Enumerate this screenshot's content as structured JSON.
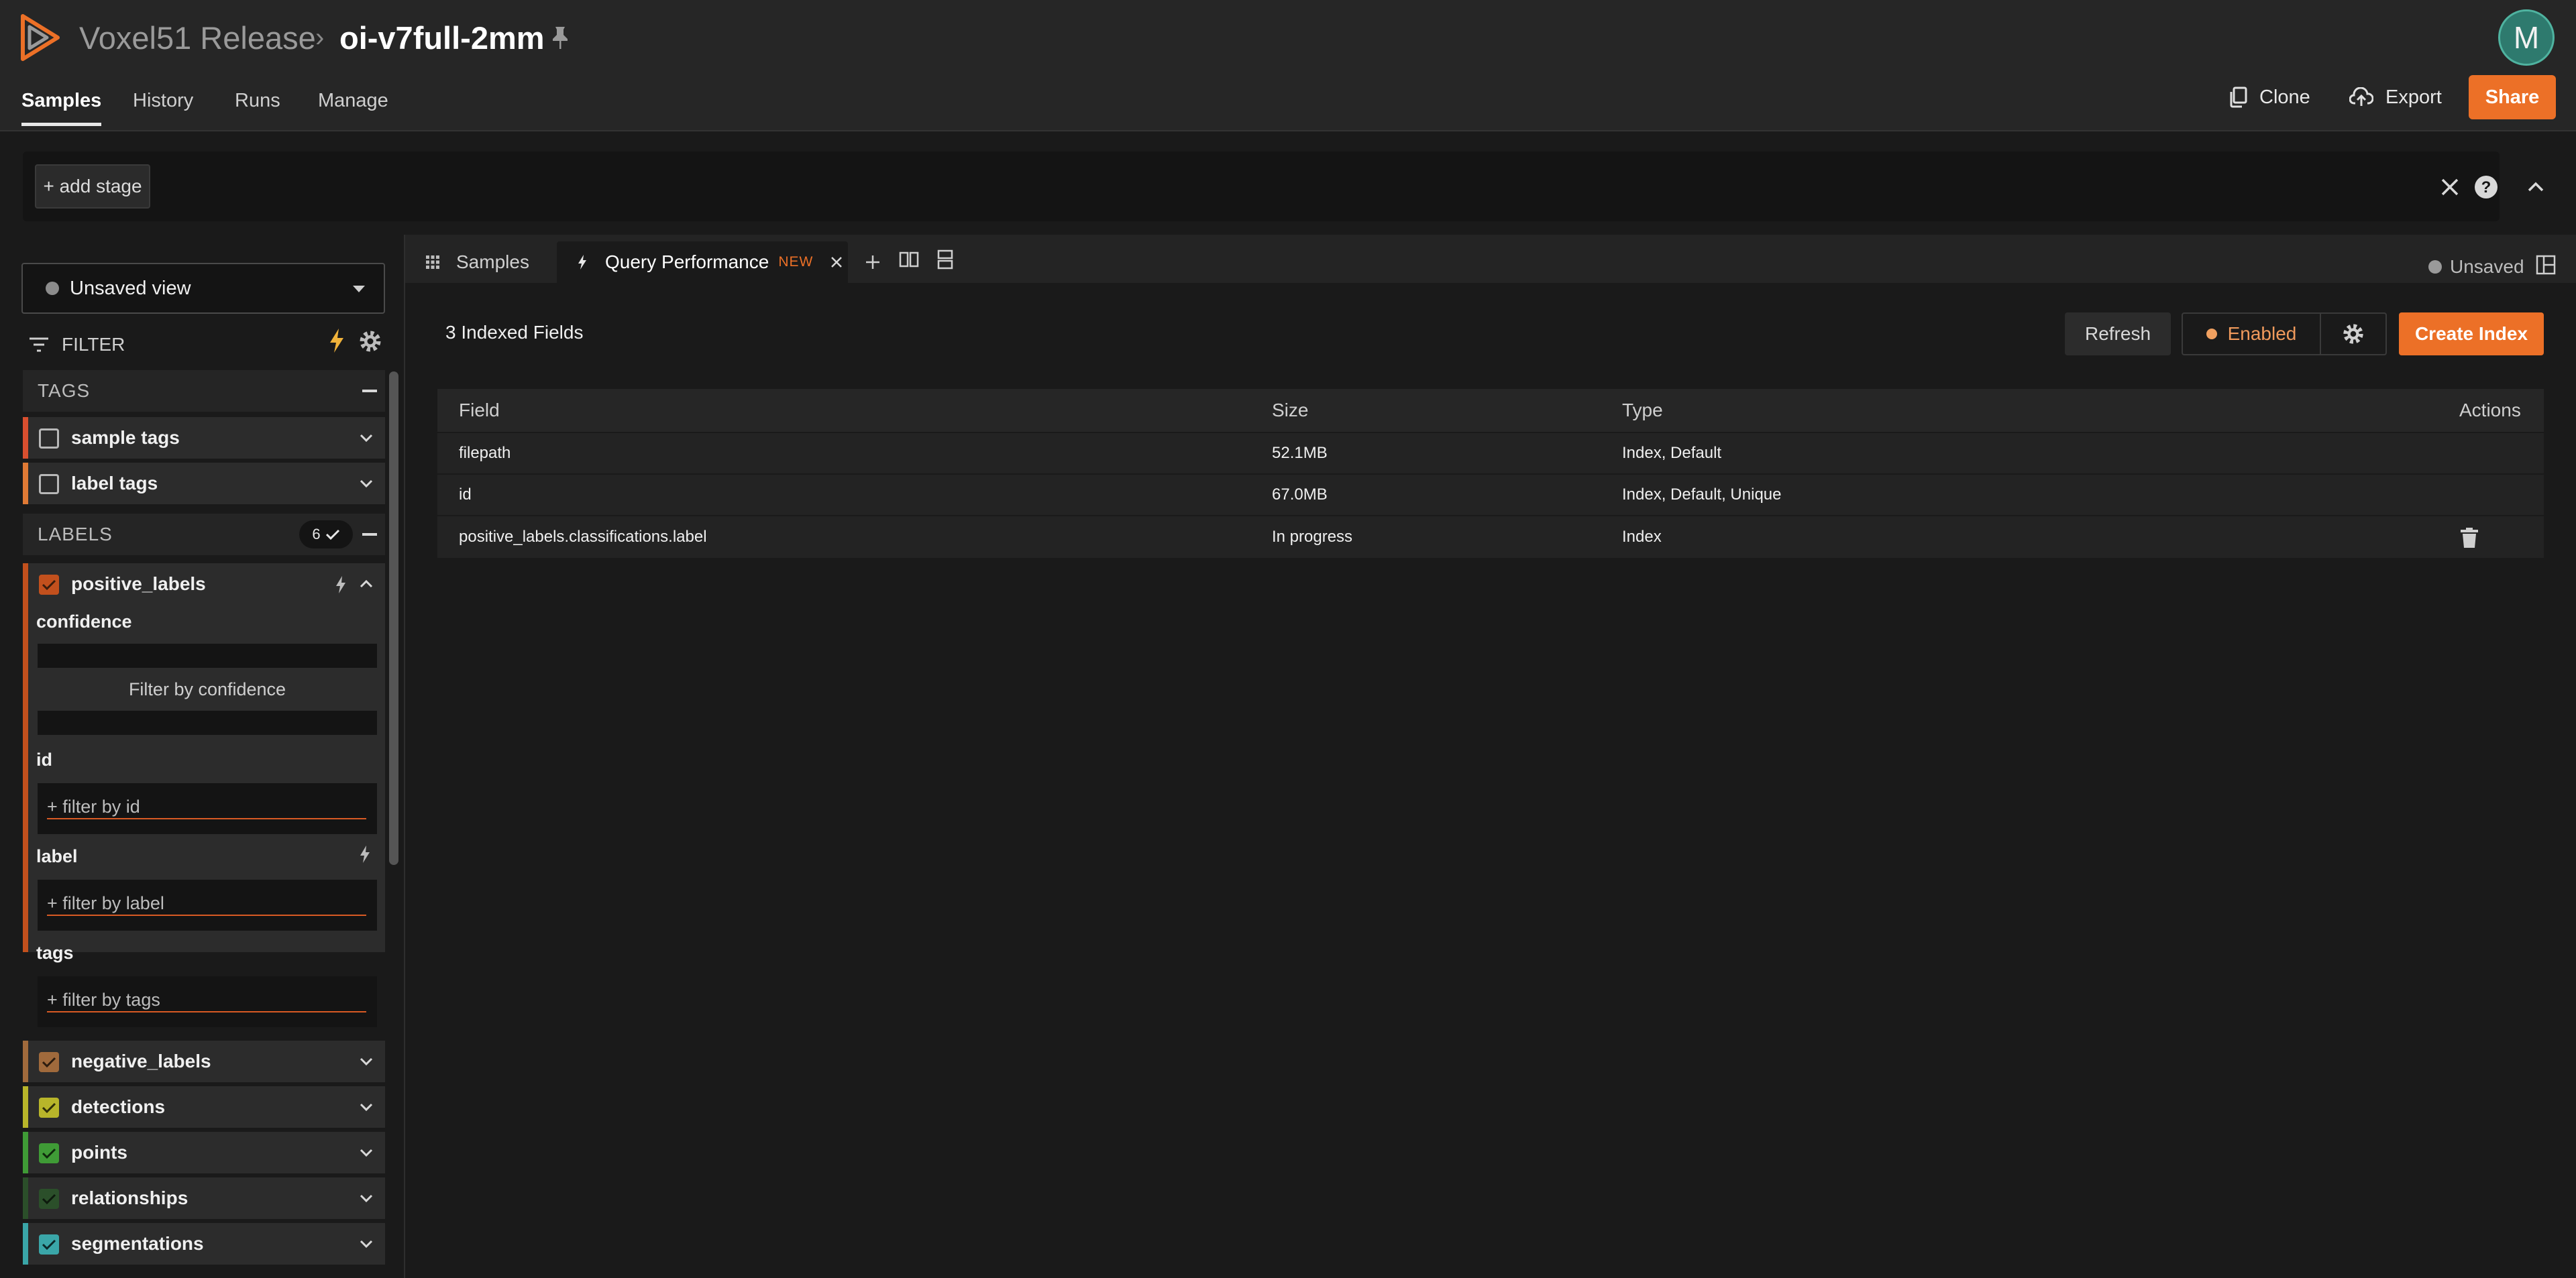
{
  "header": {
    "org": "Voxel51 Release",
    "separator": "›",
    "dataset": "oi-v7full-2mm",
    "avatar_initial": "M",
    "nav": [
      "Samples",
      "History",
      "Runs",
      "Manage"
    ],
    "actions": {
      "clone": "Clone",
      "export": "Export",
      "share": "Share"
    }
  },
  "viewbar": {
    "add_stage": "+ add stage"
  },
  "sidebar": {
    "view_select": "Unsaved view",
    "filter_title": "FILTER",
    "tags_group": "TAGS",
    "tag_rows": [
      "sample tags",
      "label tags"
    ],
    "labels_group": "LABELS",
    "labels_badge": "6",
    "expanded_field": "positive_labels",
    "sub_fields": {
      "confidence": "confidence",
      "confidence_btn": "Filter by confidence",
      "id": "id",
      "id_placeholder": "+ filter by id",
      "label": "label",
      "label_placeholder": "+ filter by label",
      "tags": "tags",
      "tags_placeholder": "+ filter by tags"
    },
    "other_fields": [
      "negative_labels",
      "detections",
      "points",
      "relationships",
      "segmentations"
    ]
  },
  "tabs": {
    "samples": "Samples",
    "query_performance": "Query Performance",
    "new_badge": "NEW",
    "status": "Unsaved"
  },
  "query_performance": {
    "indexed_count": "3 Indexed Fields",
    "refresh": "Refresh",
    "enabled": "Enabled",
    "create_index": "Create Index",
    "columns": [
      "Field",
      "Size",
      "Type",
      "Actions"
    ],
    "rows": [
      {
        "field": "filepath",
        "size": "52.1MB",
        "type": "Index, Default"
      },
      {
        "field": "id",
        "size": "67.0MB",
        "type": "Index, Default, Unique"
      },
      {
        "field": "positive_labels.classifications.label",
        "size": "In progress",
        "type": "Index"
      }
    ]
  },
  "colors": {
    "accent": "#ec7027",
    "sample_tags": "#d94f2f",
    "label_tags": "#e07a35",
    "positive_labels": "#c2501d",
    "negative_labels": "#a06a3c",
    "detections": "#b8b52a",
    "points": "#3f9b36",
    "relationships": "#2b4f2a",
    "segmentations": "#3aa6a8"
  },
  "icons": [
    "logo-icon",
    "pin-icon",
    "clone-icon",
    "export-icon",
    "close-icon",
    "help-icon",
    "chevron-up-icon",
    "filter-icon",
    "bolt-icon",
    "gear-icon",
    "grid-icon",
    "plus-icon",
    "split-horizontal-icon",
    "split-vertical-icon",
    "layout-icon",
    "trash-icon",
    "check-icon",
    "chevron-down-icon"
  ]
}
